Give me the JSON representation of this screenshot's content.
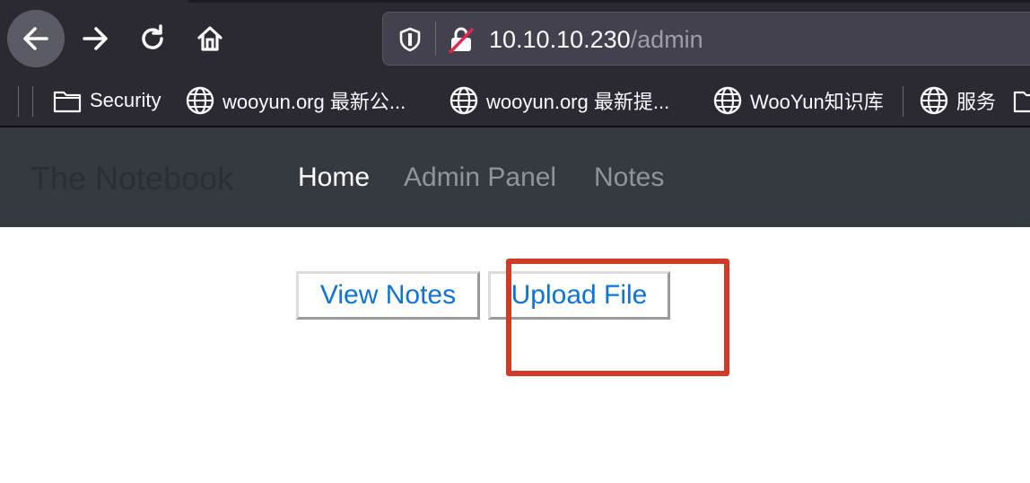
{
  "browser": {
    "url_host": "10.10.10.230",
    "url_path": "/admin",
    "icons": {
      "back": "arrow-left-icon",
      "forward": "arrow-right-icon",
      "reload": "reload-icon",
      "home": "home-icon",
      "tracking": "shield-icon",
      "insecure": "insecure-lock-icon"
    }
  },
  "bookmarks": [
    {
      "label": "Security",
      "icon": "folder-icon"
    },
    {
      "label": "wooyun.org 最新公...",
      "icon": "globe-icon"
    },
    {
      "label": "wooyun.org 最新提...",
      "icon": "globe-icon"
    },
    {
      "label": "WooYun知识库",
      "icon": "globe-icon"
    },
    {
      "label": "服务",
      "icon": "globe-icon"
    }
  ],
  "navbar": {
    "brand": "The Notebook",
    "links": [
      {
        "label": "Home",
        "active": true
      },
      {
        "label": "Admin Panel",
        "active": false
      },
      {
        "label": "Notes",
        "active": false
      }
    ]
  },
  "main": {
    "view_notes_label": "View Notes",
    "upload_file_label": "Upload File"
  },
  "colors": {
    "browser_chrome": "#2b2a33",
    "navbar": "#343a40",
    "link_blue": "#0a74da",
    "highlight_red": "#d23a28"
  }
}
